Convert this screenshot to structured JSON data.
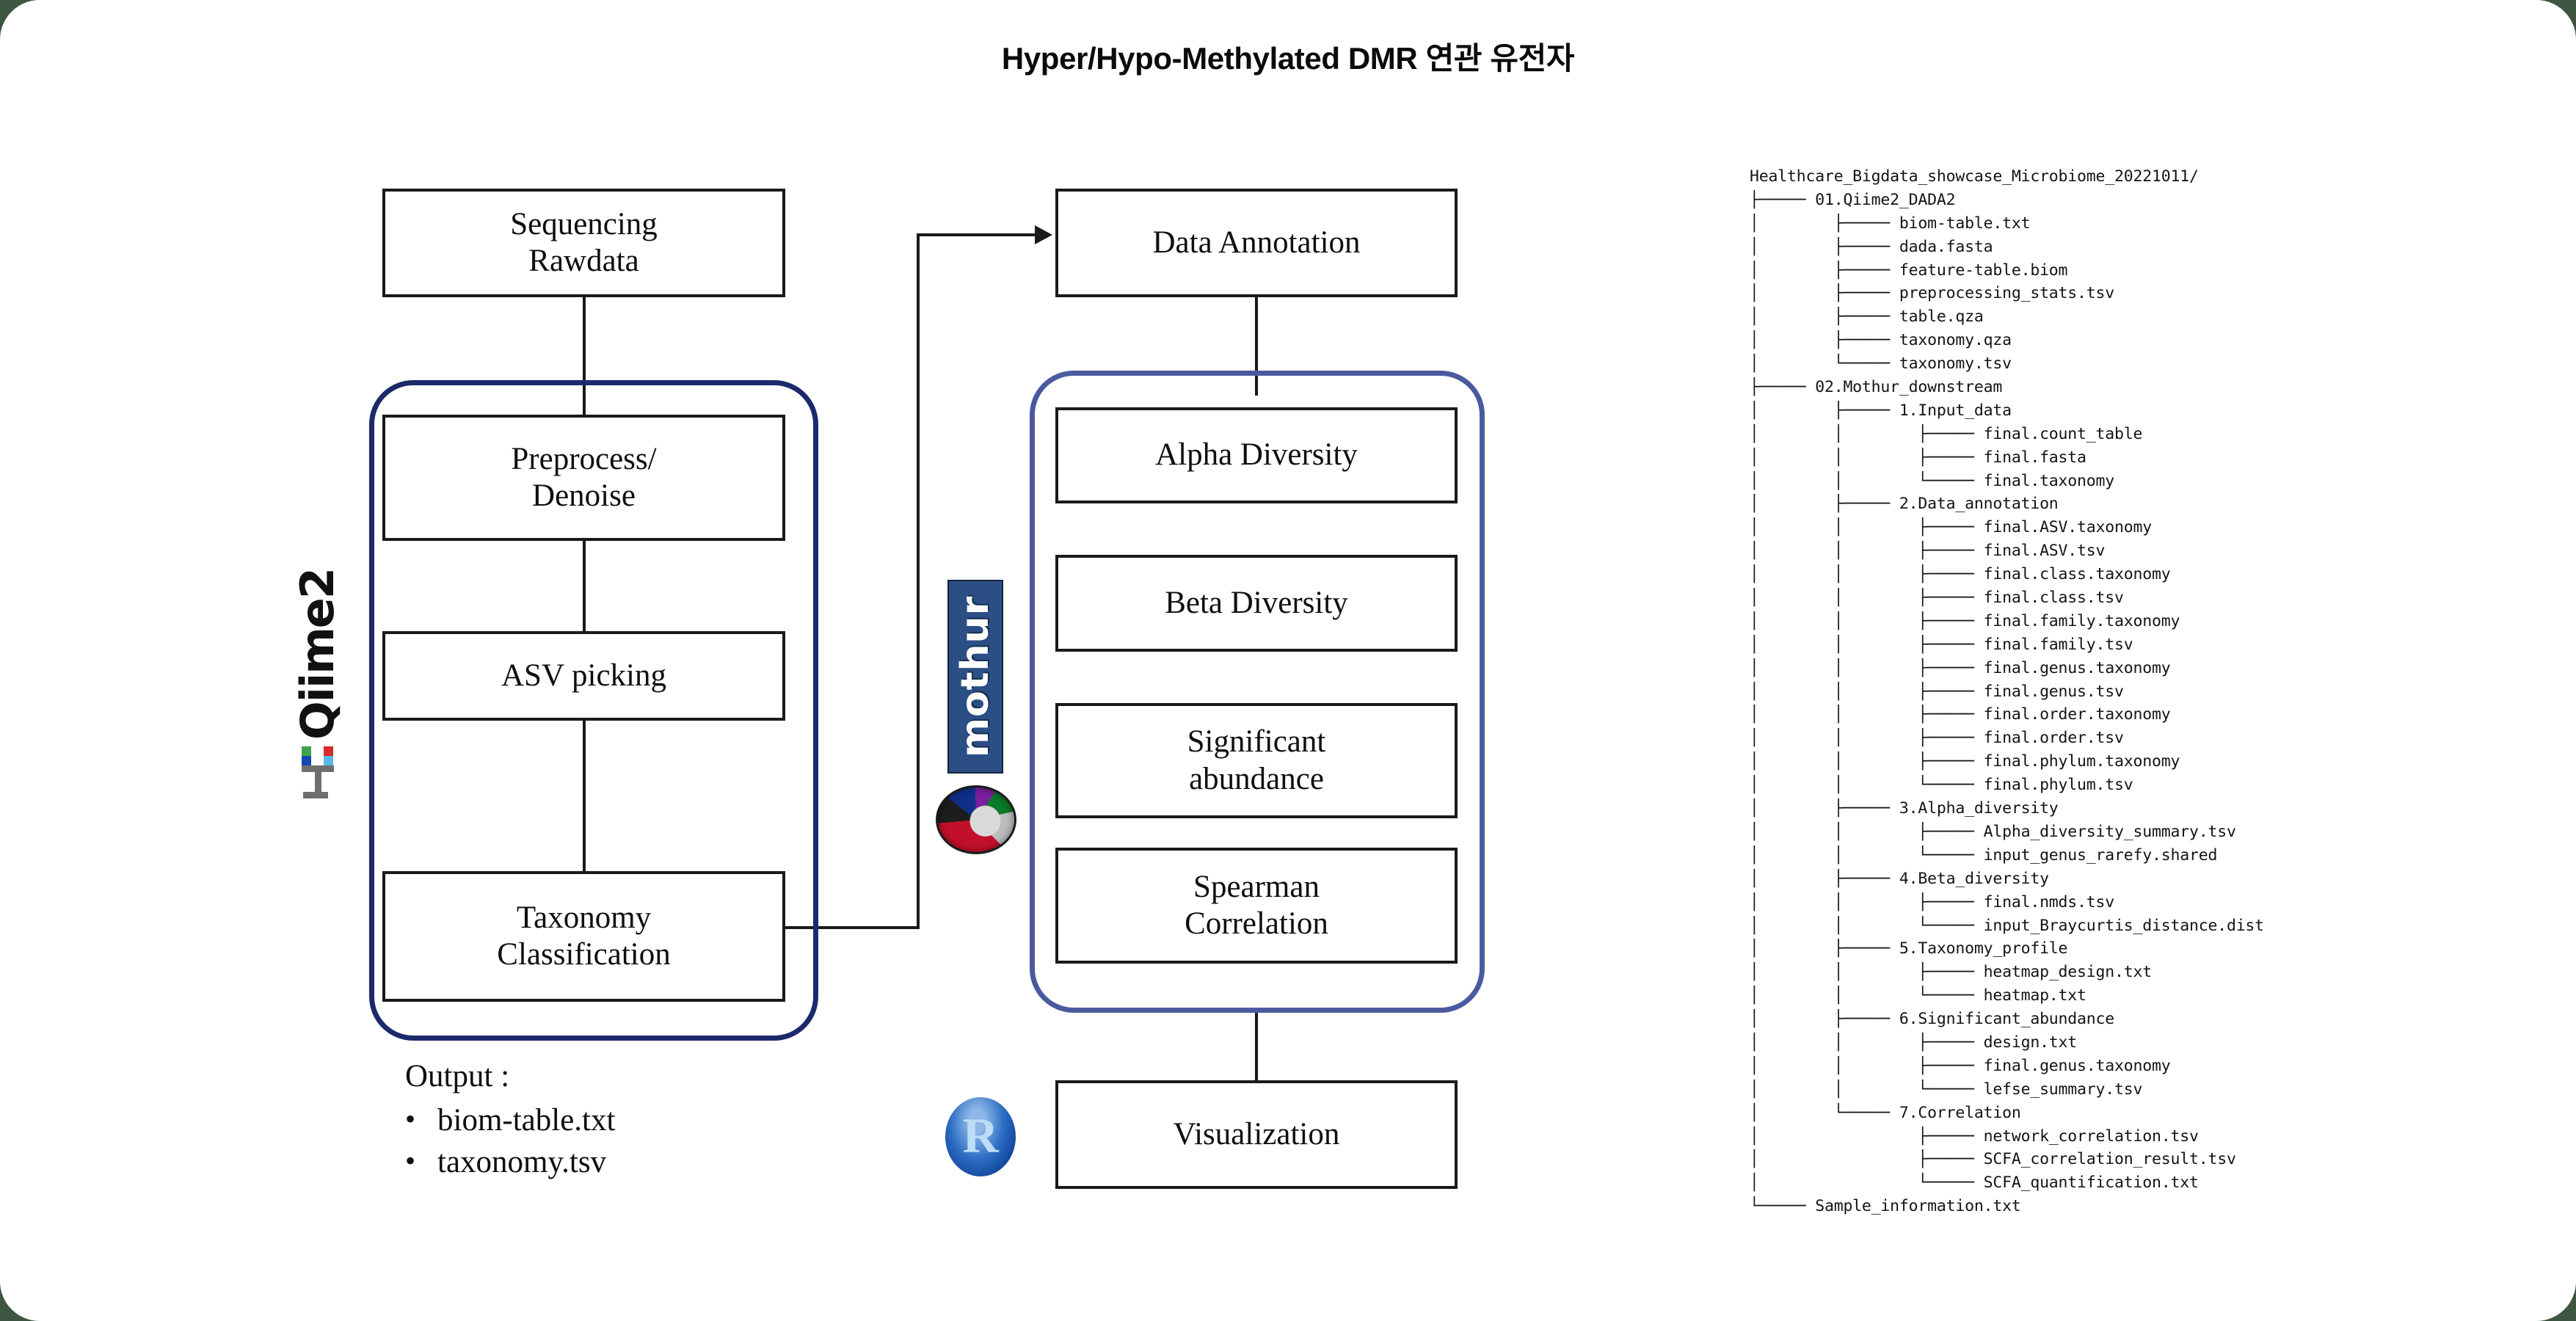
{
  "title": "Hyper/Hypo-Methylated DMR 연관 유전자",
  "colors": {
    "qiime_group_border": "#1c2a6b",
    "mothur_group_border": "#4b5a9f",
    "box_border": "#1a1a1a",
    "mothur_logo_bg": "#2b4e85",
    "r_logo_bg": "#0b3f95",
    "page_bg": "#ffffff",
    "outside_bg": "#3d5641"
  },
  "flow": {
    "input_box": "Sequencing\nRawdata",
    "qiime_group_label": "Qiime2",
    "qiime_steps": [
      "Preprocess/\nDenoise",
      "ASV picking",
      "Taxonomy\nClassification"
    ],
    "mothur_group_label": "mothur",
    "annotation_box": "Data Annotation",
    "mothur_steps": [
      "Alpha Diversity",
      "Beta Diversity",
      "Significant\nabundance",
      "Spearman\nCorrelation"
    ],
    "r_label": "R",
    "visualization_box": "Visualization"
  },
  "output": {
    "title": "Output :",
    "bullet_glyph": "•",
    "items": [
      "biom-table.txt",
      "taxonomy.tsv"
    ]
  },
  "file_tree": {
    "root": "Healthcare_Bigdata_showcase_Microbiome_20221011/",
    "lines": [
      "Healthcare_Bigdata_showcase_Microbiome_20221011/",
      "├───── 01.Qiime2_DADA2",
      "│        ├───── biom-table.txt",
      "│        ├───── dada.fasta",
      "│        ├───── feature-table.biom",
      "│        ├───── preprocessing_stats.tsv",
      "│        ├───── table.qza",
      "│        ├───── taxonomy.qza",
      "│        └───── taxonomy.tsv",
      "├───── 02.Mothur_downstream",
      "│        ├───── 1.Input_data",
      "│        │        ├───── final.count_table",
      "│        │        ├───── final.fasta",
      "│        │        └───── final.taxonomy",
      "│        ├───── 2.Data_annotation",
      "│        │        ├───── final.ASV.taxonomy",
      "│        │        ├───── final.ASV.tsv",
      "│        │        ├───── final.class.taxonomy",
      "│        │        ├───── final.class.tsv",
      "│        │        ├───── final.family.taxonomy",
      "│        │        ├───── final.family.tsv",
      "│        │        ├───── final.genus.taxonomy",
      "│        │        ├───── final.genus.tsv",
      "│        │        ├───── final.order.taxonomy",
      "│        │        ├───── final.order.tsv",
      "│        │        ├───── final.phylum.taxonomy",
      "│        │        └───── final.phylum.tsv",
      "│        ├───── 3.Alpha_diversity",
      "│        │        ├───── Alpha_diversity_summary.tsv",
      "│        │        └───── input_genus_rarefy.shared",
      "│        ├───── 4.Beta_diversity",
      "│        │        ├───── final.nmds.tsv",
      "│        │        └───── input_Braycurtis_distance.dist",
      "│        ├───── 5.Taxonomy_profile",
      "│        │        ├───── heatmap_design.txt",
      "│        │        └───── heatmap.txt",
      "│        ├───── 6.Significant_abundance",
      "│        │        ├───── design.txt",
      "│        │        ├───── final.genus.taxonomy",
      "│        │        └───── lefse_summary.tsv",
      "│        └───── 7.Correlation",
      "│                 ├───── network_correlation.tsv",
      "│                 ├───── SCFA_correlation_result.tsv",
      "│                 └───── SCFA_quantification.txt",
      "└───── Sample_information.txt"
    ]
  }
}
